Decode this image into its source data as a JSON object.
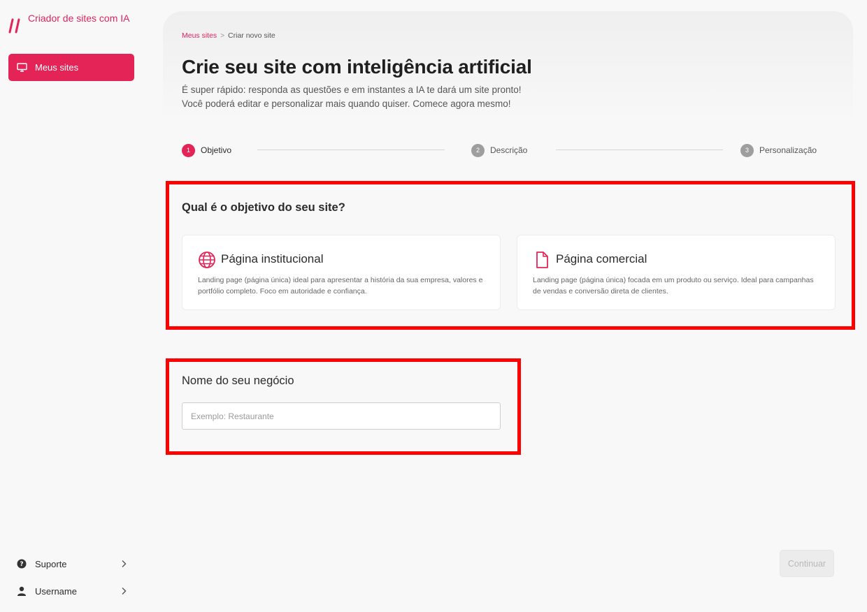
{
  "brand": {
    "title": "Criador de sites com IA",
    "accent_color": "#e42357"
  },
  "sidebar": {
    "nav_items": [
      {
        "label": "Meus sites",
        "icon": "monitor-icon",
        "active": true
      }
    ],
    "bottom_items": [
      {
        "label": "Suporte",
        "icon": "help-circle-icon"
      },
      {
        "label": "Username",
        "icon": "user-icon"
      }
    ]
  },
  "breadcrumb": {
    "items": [
      "Meus sites",
      "Criar novo site"
    ],
    "separator": ">"
  },
  "header": {
    "title": "Crie seu site com inteligência artificial",
    "subtitle_line1": "É super rápido: responda as questões e em instantes a IA te dará um site pronto!",
    "subtitle_line2": "Você poderá editar e personalizar mais quando quiser. Comece agora mesmo!"
  },
  "stepper": {
    "steps": [
      {
        "number": "1",
        "label": "Objetivo",
        "active": true
      },
      {
        "number": "2",
        "label": "Descrição",
        "active": false
      },
      {
        "number": "3",
        "label": "Personalização",
        "active": false
      }
    ]
  },
  "objective": {
    "question": "Qual é o objetivo do seu site?",
    "options": [
      {
        "title": "Página institucional",
        "icon": "globe-icon",
        "description": "Landing page (página única) ideal para apresentar a história da sua empresa, valores e portfólio completo. Foco em autoridade e confiança."
      },
      {
        "title": "Página comercial",
        "icon": "document-icon",
        "description": "Landing page (página única) focada em um produto ou serviço. Ideal para campanhas de vendas e conversão direta de clientes."
      }
    ]
  },
  "business": {
    "label": "Nome do seu negócio",
    "placeholder": "Exemplo: Restaurante",
    "value": ""
  },
  "footer": {
    "continue_label": "Continuar",
    "continue_disabled": true
  }
}
